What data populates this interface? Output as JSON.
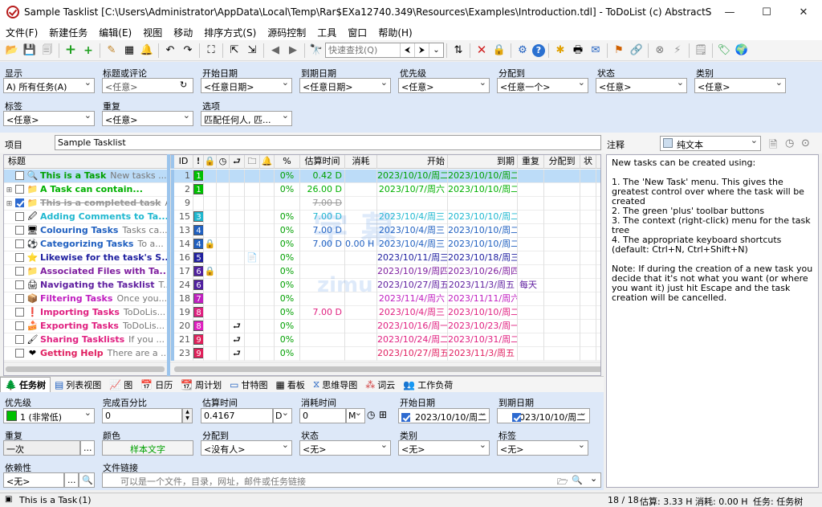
{
  "window": {
    "title": "Sample Tasklist [C:\\Users\\Administrator\\AppData\\Local\\Temp\\Rar$EXa12740.349\\Resources\\Examples\\Introduction.tdl] - ToDoList (c) AbstractSpoon",
    "minimize": "—",
    "maximize": "☐",
    "close": "✕"
  },
  "menu": [
    "文件(F)",
    "新建任务",
    "编辑(E)",
    "视图",
    "移动",
    "排序方式(S)",
    "源码控制",
    "工具",
    "窗口",
    "帮助(H)"
  ],
  "toolbar": {
    "quickfind_placeholder": "快速查找(Q)"
  },
  "filter": {
    "show": {
      "label": "显示",
      "value": "A) 所有任务(A)"
    },
    "title": {
      "label": "标题或评论",
      "placeholder": "<任意>"
    },
    "start": {
      "label": "开始日期",
      "value": "<任意日期>"
    },
    "due": {
      "label": "到期日期",
      "value": "<任意日期>"
    },
    "priority": {
      "label": "优先级",
      "value": "<任意>"
    },
    "alloc": {
      "label": "分配到",
      "value": "<任意一个>"
    },
    "status": {
      "label": "状态",
      "value": "<任意>"
    },
    "category": {
      "label": "类别",
      "value": "<任意>"
    },
    "tag": {
      "label": "标签",
      "value": "<任意>"
    },
    "recur": {
      "label": "重复",
      "value": "<任意>"
    },
    "options": {
      "label": "选项",
      "value": "匹配任何人, 匹..."
    }
  },
  "project": {
    "label": "项目",
    "value": "Sample Tasklist"
  },
  "notes": {
    "label": "注释",
    "format": "纯文本",
    "text": "New tasks can be created using:\n\n1. The 'New Task' menu. This gives the greatest control over where the task will be created\n2. The green 'plus' toolbar buttons\n3. The context (right-click) menu for the task tree\n4. The appropriate keyboard shortcuts (default: Ctrl+N, Ctrl+Shift+N)\n\nNote: If during the creation of a new task you decide that it's not what you want (or where you want it) just hit Escape and the task creation will be cancelled."
  },
  "columns": {
    "title": "标题",
    "id": "ID",
    "pct": "%",
    "est": "估算时间",
    "spent": "消耗",
    "start": "开始",
    "due": "到期",
    "recur": "重复",
    "alloc": "分配到",
    "status": "状"
  },
  "tasks": [
    {
      "name": "This is a Task",
      "comment": "New tasks ...",
      "color": "#00a000",
      "icon": "🔍",
      "expand": "",
      "done": false,
      "id": "1",
      "prio": "1",
      "prioColor": "#00c000",
      "pct": "0%",
      "est": "0.42 D",
      "spent": "",
      "start": "2023/10/10/周二",
      "due": "2023/10/10/周二",
      "recur": "",
      "lock": "",
      "file": "",
      "dep": "",
      "sel": true
    },
    {
      "name": "A Task can contain...",
      "comment": "",
      "color": "#00b000",
      "icon": "📁",
      "expand": "⊞",
      "done": false,
      "id": "2",
      "prio": "1",
      "prioColor": "#00c000",
      "pct": "0%",
      "est": "26.00 D",
      "spent": "",
      "start": "2023/10/7/周六",
      "due": "2023/10/10/周二",
      "recur": "",
      "lock": "",
      "file": "",
      "dep": "",
      "sel": false
    },
    {
      "name": "This is a completed task",
      "comment": "A...",
      "color": "#999999",
      "icon": "📁",
      "expand": "⊞",
      "done": true,
      "id": "9",
      "prio": "",
      "prioColor": "",
      "pct": "",
      "est": "7.00 D",
      "spent": "",
      "start": "",
      "due": "",
      "recur": "",
      "lock": "",
      "file": "",
      "dep": "",
      "sel": false
    },
    {
      "name": "Adding Comments to Ta...",
      "comment": "",
      "color": "#20b8d0",
      "icon": "🖉",
      "expand": "",
      "done": false,
      "id": "15",
      "prio": "3",
      "prioColor": "#20b8d0",
      "pct": "0%",
      "est": "7.00 D",
      "spent": "",
      "start": "2023/10/4/周三",
      "due": "2023/10/10/周二",
      "recur": "",
      "lock": "",
      "file": "",
      "dep": "",
      "sel": false
    },
    {
      "name": "Colouring Tasks",
      "comment": "Tasks ca...",
      "color": "#2060c0",
      "icon": "🖥",
      "expand": "",
      "done": false,
      "id": "13",
      "prio": "4",
      "prioColor": "#2060c0",
      "pct": "0%",
      "est": "7.00 D",
      "spent": "",
      "start": "2023/10/4/周三",
      "due": "2023/10/10/周二",
      "recur": "",
      "lock": "",
      "file": "",
      "dep": "",
      "sel": false
    },
    {
      "name": "Categorizing Tasks",
      "comment": "To a...",
      "color": "#2060c0",
      "icon": "⚽",
      "expand": "",
      "done": false,
      "id": "14",
      "prio": "4",
      "prioColor": "#2060c0",
      "pct": "0%",
      "est": "7.00 D",
      "spent": "0.00 H",
      "start": "2023/10/4/周三",
      "due": "2023/10/10/周二",
      "recur": "",
      "lock": "🔒",
      "file": "",
      "dep": "",
      "sel": false
    },
    {
      "name": "Likewise for the task's S...",
      "comment": "",
      "color": "#2020a0",
      "icon": "⭐",
      "expand": "",
      "done": false,
      "id": "16",
      "prio": "5",
      "prioColor": "#2020a0",
      "pct": "0%",
      "est": "",
      "spent": "",
      "start": "2023/10/11/周三",
      "due": "2023/10/18/周三",
      "recur": "",
      "lock": "",
      "file": "📄",
      "dep": "",
      "sel": false
    },
    {
      "name": "Associated Files with Ta...",
      "comment": "",
      "color": "#8020a0",
      "icon": "📁",
      "expand": "",
      "done": false,
      "id": "17",
      "prio": "6",
      "prioColor": "#5020a0",
      "pct": "0%",
      "est": "",
      "spent": "",
      "start": "2023/10/19/周四",
      "due": "2023/10/26/周四",
      "recur": "",
      "lock": "🔒",
      "file": "",
      "dep": "",
      "sel": false
    },
    {
      "name": "Navigating the Tasklist",
      "comment": "T...",
      "color": "#6020a0",
      "icon": "🖨",
      "expand": "",
      "done": false,
      "id": "24",
      "prio": "6",
      "prioColor": "#5020a0",
      "pct": "0%",
      "est": "",
      "spent": "",
      "start": "2023/10/27/周五",
      "due": "2023/11/3/周五",
      "recur": "每天",
      "lock": "",
      "file": "",
      "dep": "",
      "sel": false
    },
    {
      "name": "Filtering Tasks",
      "comment": "Once you...",
      "color": "#c020c0",
      "icon": "📦",
      "expand": "",
      "done": false,
      "id": "18",
      "prio": "7",
      "prioColor": "#c020c0",
      "pct": "0%",
      "est": "",
      "spent": "",
      "start": "2023/11/4/周六",
      "due": "2023/11/11/周六",
      "recur": "",
      "lock": "",
      "file": "",
      "dep": "",
      "sel": false
    },
    {
      "name": "Importing Tasks",
      "comment": "ToDoLis...",
      "color": "#e02080",
      "icon": "❗",
      "expand": "",
      "done": false,
      "id": "19",
      "prio": "8",
      "prioColor": "#e02080",
      "pct": "0%",
      "est": "7.00 D",
      "spent": "",
      "start": "2023/10/4/周三",
      "due": "2023/10/10/周二",
      "recur": "",
      "lock": "",
      "file": "",
      "dep": "",
      "sel": false
    },
    {
      "name": "Exporting Tasks",
      "comment": "ToDoLis...",
      "color": "#e02080",
      "icon": "🍰",
      "expand": "",
      "done": false,
      "id": "20",
      "prio": "8",
      "prioColor": "#e020c0",
      "pct": "0%",
      "est": "",
      "spent": "",
      "start": "2023/10/16/周一",
      "due": "2023/10/23/周一",
      "recur": "",
      "lock": "",
      "file": "",
      "dep": "⮐",
      "sel": false
    },
    {
      "name": "Sharing Tasklists",
      "comment": "If you ...",
      "color": "#e02080",
      "icon": "🖌",
      "expand": "",
      "done": false,
      "id": "21",
      "prio": "9",
      "prioColor": "#e0205a",
      "pct": "0%",
      "est": "",
      "spent": "",
      "start": "2023/10/24/周二",
      "due": "2023/10/31/周二",
      "recur": "",
      "lock": "",
      "file": "",
      "dep": "⮐",
      "sel": false
    },
    {
      "name": "Getting Help",
      "comment": "There are a ...",
      "color": "#e02060",
      "icon": "❤",
      "expand": "",
      "done": false,
      "id": "23",
      "prio": "9",
      "prioColor": "#e0205a",
      "pct": "0%",
      "est": "",
      "spent": "",
      "start": "2023/10/27/周五",
      "due": "2023/11/3/周五",
      "recur": "",
      "lock": "",
      "file": "",
      "dep": "⮐",
      "sel": false
    }
  ],
  "viewTabs": [
    "任务树",
    "列表视图",
    "图",
    "日历",
    "周计划",
    "甘特图",
    "看板",
    "思维导图",
    "词云",
    "工作负荷"
  ],
  "attrs": {
    "priority": {
      "label": "优先级",
      "value": "1 (非常低)"
    },
    "percent": {
      "label": "完成百分比",
      "value": "0"
    },
    "estimate": {
      "label": "估算时间",
      "value": "0.4167",
      "unit": "D"
    },
    "spent": {
      "label": "消耗时间",
      "value": "0",
      "unit": "M"
    },
    "start": {
      "label": "开始日期",
      "value": "2023/10/10/周二"
    },
    "due": {
      "label": "到期日期",
      "value": "2023/10/10/周二"
    },
    "recur": {
      "label": "重复",
      "value": "一次"
    },
    "color": {
      "label": "颜色",
      "value": "样本文字"
    },
    "alloc": {
      "label": "分配到",
      "value": "<没有人>"
    },
    "status": {
      "label": "状态",
      "value": "<无>"
    },
    "category": {
      "label": "类别",
      "value": "<无>"
    },
    "tag": {
      "label": "标签",
      "value": "<无>"
    },
    "depends": {
      "label": "依赖性",
      "value": "<无>"
    },
    "filelink": {
      "label": "文件链接",
      "placeholder": "可以是一个文件，目录，网址，邮件或任务链接"
    }
  },
  "status": {
    "task": "This is a Task",
    "count": "(1)",
    "total": "18 / 18",
    "est": "估算: 3.33 H",
    "spent": "消耗: 0.00 H",
    "view": "任务: 任务树"
  }
}
